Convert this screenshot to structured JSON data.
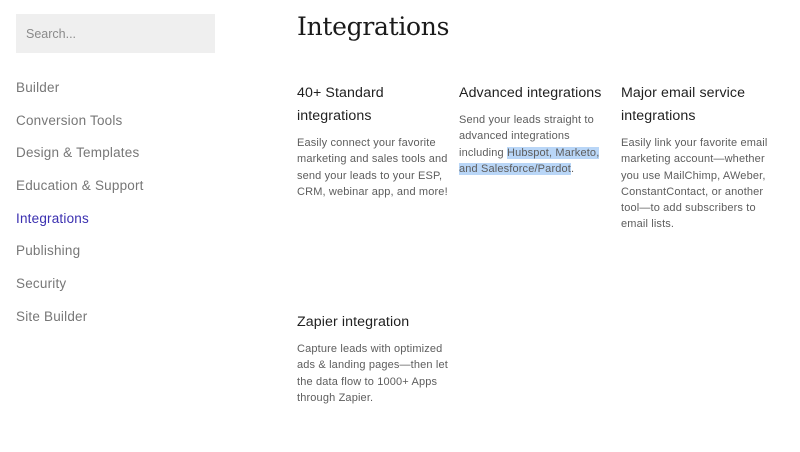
{
  "search": {
    "placeholder": "Search..."
  },
  "sidebar": {
    "items": [
      {
        "label": "Builder"
      },
      {
        "label": "Conversion Tools"
      },
      {
        "label": "Design & Templates"
      },
      {
        "label": "Education & Support"
      },
      {
        "label": "Integrations"
      },
      {
        "label": "Publishing"
      },
      {
        "label": "Security"
      },
      {
        "label": "Site Builder"
      }
    ],
    "active_index": 4
  },
  "main": {
    "title": "Integrations",
    "cards": [
      {
        "title": "40+ Standard integrations",
        "body": "Easily connect your favorite marketing and sales tools and send your leads to your ESP, CRM, webinar app, and more!"
      },
      {
        "title": "Advanced integrations",
        "body_prefix": "Send your leads straight to advanced integrations including ",
        "body_highlight": "Hubspot, Marketo, and Salesforce/Pardot",
        "body_suffix": "."
      },
      {
        "title": "Major email service integrations",
        "body": "Easily link your favorite email marketing account—whether you use MailChimp, AWeber, ConstantContact, or another tool—to add subscribers to email lists."
      },
      {
        "title": "Zapier integration",
        "body": "Capture leads with optimized ads & landing pages—then let the data flow to 1000+ Apps through Zapier."
      }
    ]
  },
  "colors": {
    "active_nav": "#3a2fb0",
    "highlight": "#b9d6f7",
    "search_bg": "#efefef"
  }
}
